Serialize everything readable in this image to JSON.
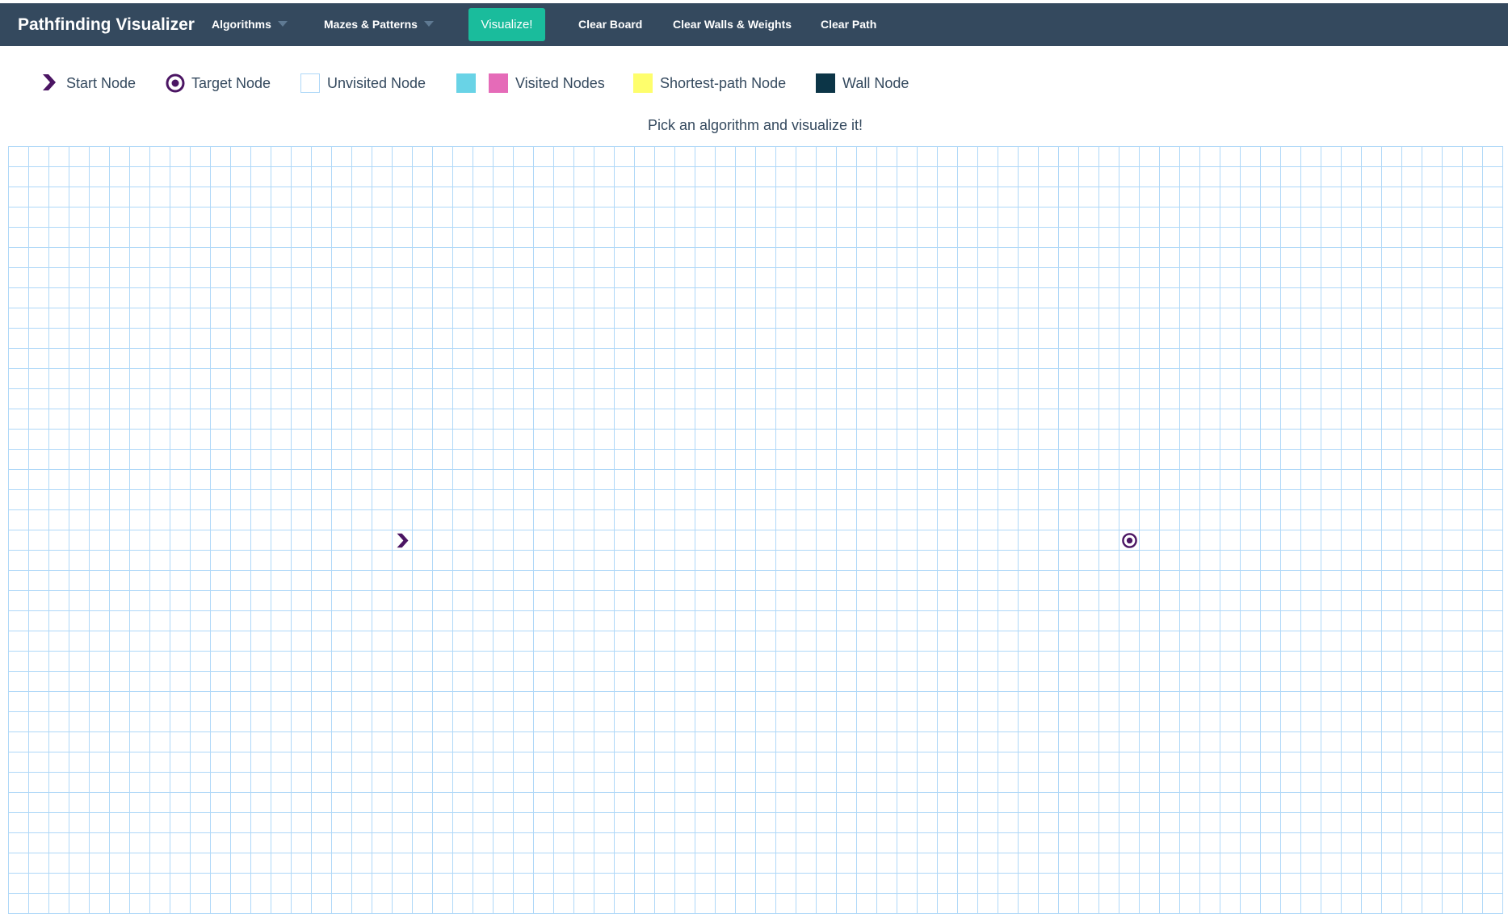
{
  "navbar": {
    "brand": "Pathfinding Visualizer",
    "algorithms_label": "Algorithms",
    "mazes_label": "Mazes & Patterns",
    "visualize_label": "Visualize!",
    "clear_board_label": "Clear Board",
    "clear_walls_label": "Clear Walls & Weights",
    "clear_path_label": "Clear Path"
  },
  "legend": {
    "start": "Start Node",
    "target": "Target Node",
    "unvisited": "Unvisited Node",
    "visited": "Visited Nodes",
    "shortest": "Shortest-path Node",
    "wall": "Wall Node"
  },
  "instruction": "Pick an algorithm and visualize it!",
  "grid": {
    "rows": 38,
    "cols": 74,
    "start": {
      "row": 19,
      "col": 19
    },
    "target": {
      "row": 19,
      "col": 55
    }
  },
  "colors": {
    "navbar_bg": "#34495e",
    "visualize_bg": "#1abc9c",
    "node_icon": "#4b1563",
    "grid_line": "#afd8f8",
    "visited_a": "#69d3e6",
    "visited_b": "#e56bb8",
    "shortest": "#fefe6c",
    "wall": "#0c3547"
  },
  "icons": {
    "start": "chevron-right-icon",
    "target": "bullseye-icon"
  }
}
